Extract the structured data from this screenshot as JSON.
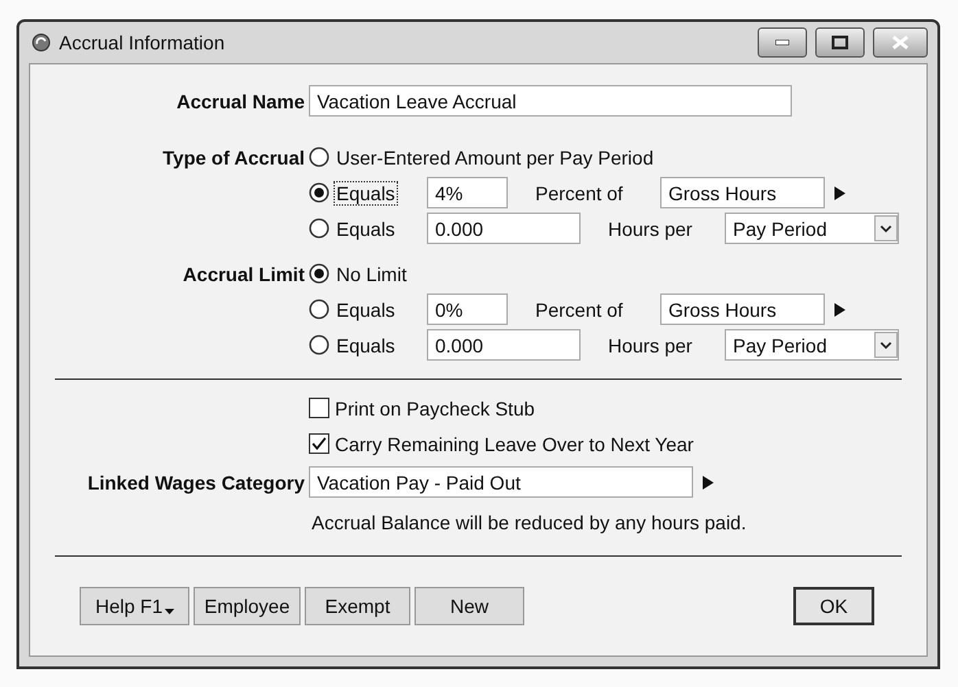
{
  "window": {
    "title": "Accrual Information"
  },
  "accrual_name": {
    "label": "Accrual Name",
    "value": "Vacation Leave Accrual"
  },
  "type_of_accrual": {
    "label": "Type of Accrual",
    "options": [
      {
        "kind": "plain",
        "label": "User-Entered Amount per Pay Period",
        "selected": false,
        "focused": false
      },
      {
        "kind": "percent",
        "label": "Equals",
        "value": "4%",
        "unit_label": "Percent of",
        "basis": "Gross Hours",
        "selected": true,
        "focused": true
      },
      {
        "kind": "hours",
        "label": "Equals",
        "value": "0.000",
        "unit_label": "Hours per",
        "basis": "Pay Period",
        "selected": false,
        "focused": false
      }
    ]
  },
  "accrual_limit": {
    "label": "Accrual Limit",
    "options": [
      {
        "kind": "plain",
        "label": "No Limit",
        "selected": true,
        "focused": false
      },
      {
        "kind": "percent",
        "label": "Equals",
        "value": "0%",
        "unit_label": "Percent of",
        "basis": "Gross Hours",
        "selected": false,
        "focused": false
      },
      {
        "kind": "hours",
        "label": "Equals",
        "value": "0.000",
        "unit_label": "Hours per",
        "basis": "Pay Period",
        "selected": false,
        "focused": false
      }
    ]
  },
  "checkboxes": [
    {
      "label": "Print on Paycheck Stub",
      "checked": false
    },
    {
      "label": "Carry Remaining Leave Over to Next Year",
      "checked": true
    }
  ],
  "linked_wages": {
    "label": "Linked Wages Category",
    "value": "Vacation Pay - Paid Out",
    "note": "Accrual Balance will be reduced by any hours paid."
  },
  "buttons": [
    {
      "kind": "menu",
      "label": "Help F1"
    },
    {
      "kind": "plain",
      "label": "Employee"
    },
    {
      "kind": "plain",
      "label": "Exempt"
    },
    {
      "kind": "plain",
      "label": "New"
    }
  ],
  "ok_button": {
    "label": "OK"
  }
}
